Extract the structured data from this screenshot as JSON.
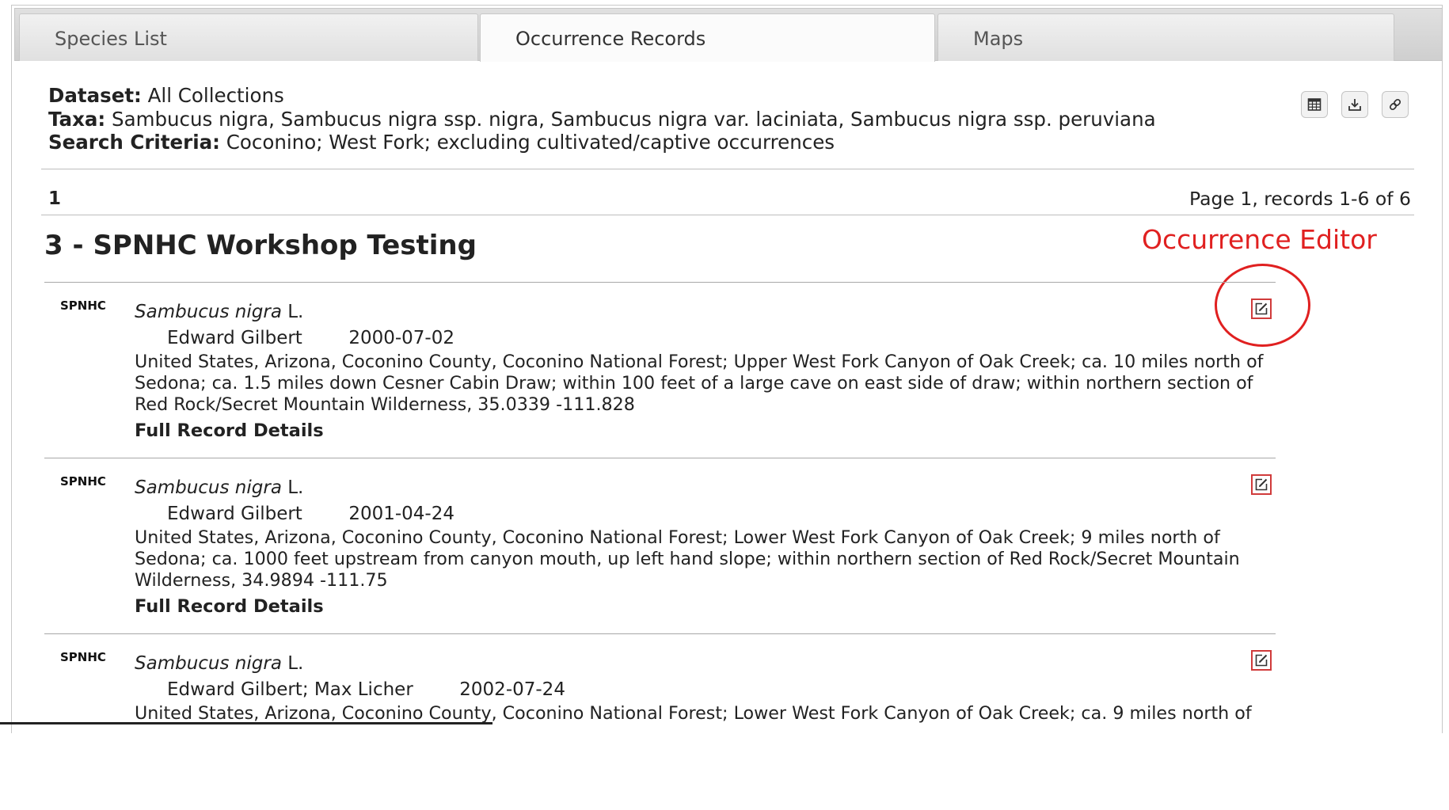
{
  "tabs": [
    {
      "label": "Species List"
    },
    {
      "label": "Occurrence Records"
    },
    {
      "label": "Maps"
    }
  ],
  "summary": {
    "dataset_label": "Dataset:",
    "dataset_value": "All Collections",
    "taxa_label": "Taxa:",
    "taxa_value": "Sambucus nigra, Sambucus nigra ssp. nigra, Sambucus nigra var. laciniata, Sambucus nigra ssp. peruviana",
    "criteria_label": "Search Criteria:",
    "criteria_value": "Coconino; West Fork; excluding cultivated/captive occurrences"
  },
  "toolbar": {
    "icons": [
      "table-icon",
      "download-icon",
      "link-icon"
    ]
  },
  "pagination": {
    "current_page": "1",
    "info": "Page 1, records 1-6 of 6"
  },
  "collection_title": "3 - SPNHC Workshop Testing",
  "annotation": {
    "label": "Occurrence Editor",
    "color": "#e02020"
  },
  "records": [
    {
      "institution": "SPNHC",
      "taxon": "Sambucus nigra",
      "author": "L.",
      "collector": "Edward Gilbert",
      "date": "2000-07-02",
      "locality": "United States, Arizona, Coconino County, Coconino National Forest; Upper West Fork Canyon of Oak Creek; ca. 10 miles north of Sedona; ca. 1.5 miles down Cesner Cabin Draw; within 100 feet of a large cave on east side of draw; within northern section of Red Rock/Secret Mountain Wilderness, 35.0339 -111.828",
      "details_link": "Full Record Details"
    },
    {
      "institution": "SPNHC",
      "taxon": "Sambucus nigra",
      "author": "L.",
      "collector": "Edward Gilbert",
      "date": "2001-04-24",
      "locality": "United States, Arizona, Coconino County, Coconino National Forest; Lower West Fork Canyon of Oak Creek; 9 miles north of Sedona; ca. 1000 feet upstream from canyon mouth, up left hand slope; within northern section of Red Rock/Secret Mountain Wilderness, 34.9894 -111.75",
      "details_link": "Full Record Details"
    },
    {
      "institution": "SPNHC",
      "taxon": "Sambucus nigra",
      "author": "L.",
      "collector": "Edward Gilbert; Max Licher",
      "date": "2002-07-24",
      "locality": "United States, Arizona, Coconino County, Coconino National Forest; Lower West Fork Canyon of Oak Creek; ca. 9 miles north of",
      "details_link": ""
    }
  ]
}
